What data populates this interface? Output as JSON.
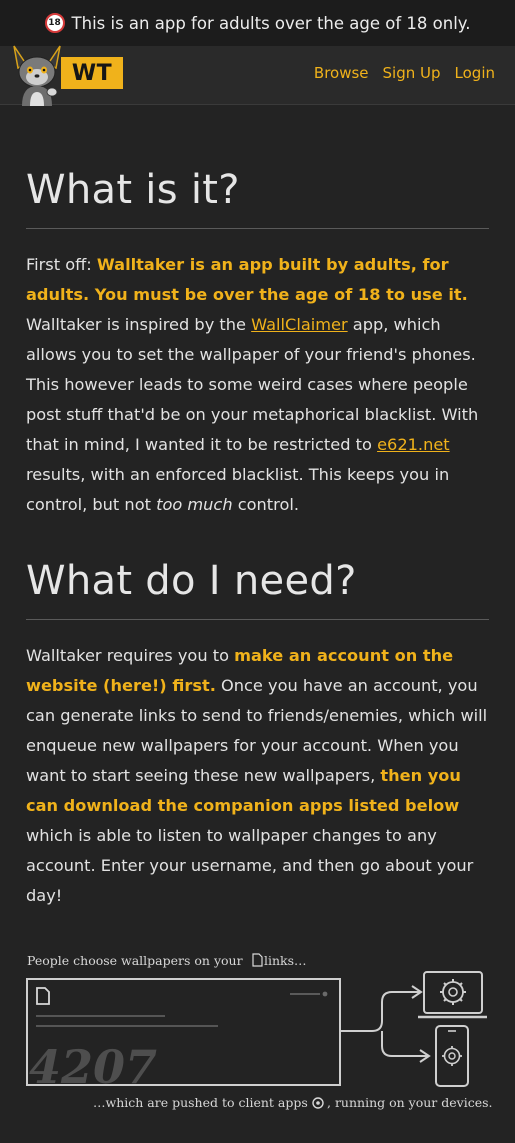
{
  "banner": {
    "icon": "18",
    "text": "This is an app for adults over the age of 18 only."
  },
  "nav": {
    "logo": "WT",
    "links": [
      "Browse",
      "Sign Up",
      "Login"
    ]
  },
  "section1": {
    "title": "What is it?",
    "p": {
      "t1": "First off: ",
      "h1": "Walltaker is an app built by adults, for adults. You must be over the age of 18 to use it.",
      "t2": " Walltaker is inspired by the ",
      "l1": "WallClaimer",
      "t3": " app, which allows you to set the wallpaper of your friend's phones. This however leads to some weird cases where people post stuff that'd be on your metaphorical blacklist. With that in mind, I wanted it to be restricted to ",
      "l2": "e621.net",
      "t4": " results, with an enforced blacklist. This keeps you in control, but not ",
      "em": "too much",
      "t5": " control."
    }
  },
  "section2": {
    "title": "What do I need?",
    "p": {
      "t1": "Walltaker requires you to ",
      "h1": "make an account on the website (here!) first.",
      "t2": " Once you have an account, you can generate links to send to friends/enemies, which will enqueue new wallpapers for your account. When you want to start seeing these new wallpapers, ",
      "h2": "then you can download the companion apps listed below",
      "t3": " which is able to listen to wallpaper changes to any account. Enter your username, and then go about your day!"
    }
  },
  "diagram": {
    "caption_top_a": "People choose wallpapers on your",
    "caption_top_b": "links…",
    "link_number": "4207",
    "caption_bottom_a": "…which are pushed to client apps",
    "caption_bottom_b": ", running on your devices."
  },
  "colors": {
    "accent": "#f0b21b",
    "background": "#232323",
    "navbar": "#2a2a2a"
  }
}
